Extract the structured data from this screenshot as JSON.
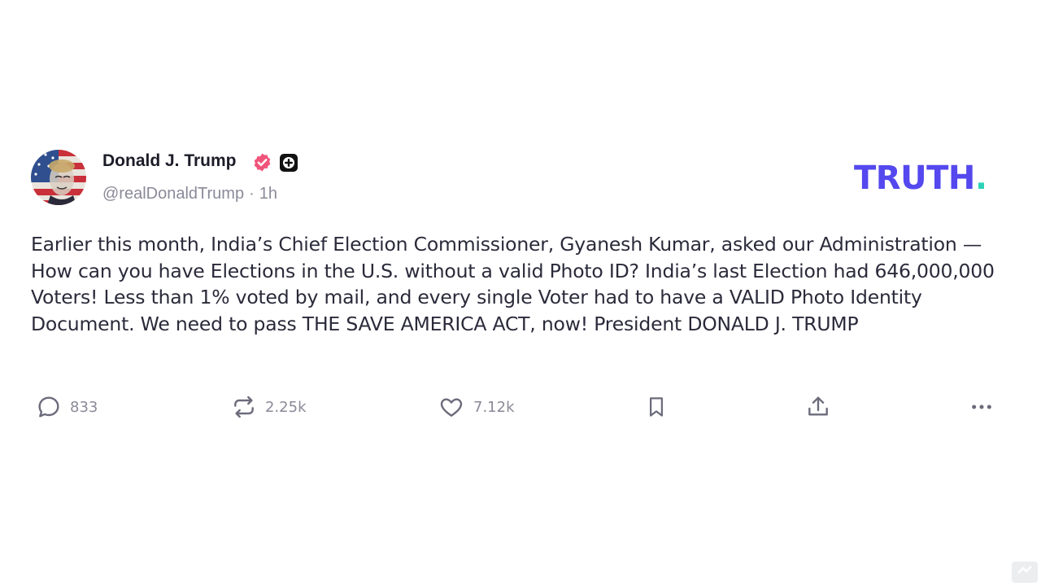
{
  "author": {
    "name": "Donald J. Trump",
    "handle": "@realDonaldTrump",
    "separator": "·",
    "time": "1h",
    "avatar_icon": "flag-portrait-avatar",
    "verified_icon": "verified-badge-icon",
    "plus_icon": "plus-badge-icon"
  },
  "brand": {
    "name": "TRUTH",
    "dot": ".",
    "color": "#5448ee",
    "dot_color": "#2ed3b7"
  },
  "post": {
    "text": "Earlier this month, India’s Chief Election Commissioner, Gyanesh Kumar, asked our Administration — How can you have Elections in the U.S. without a valid Photo ID? India’s last Election had 646,000,000 Voters! Less than 1% voted by mail, and every single Voter had to have a VALID Photo Identity Document. We need to pass THE SAVE AMERICA ACT, now! President DONALD J. TRUMP"
  },
  "actions": {
    "replies": "833",
    "retruths": "2.25k",
    "likes": "7.12k",
    "icons": [
      "comment-icon",
      "retruth-icon",
      "heart-icon",
      "bookmark-icon",
      "share-icon",
      "more-icon"
    ]
  },
  "colors": {
    "badge_pink": "#f0547a",
    "icon_gray": "#6b6b7b",
    "text": "#2a2a3a",
    "muted": "#8a8a99"
  }
}
